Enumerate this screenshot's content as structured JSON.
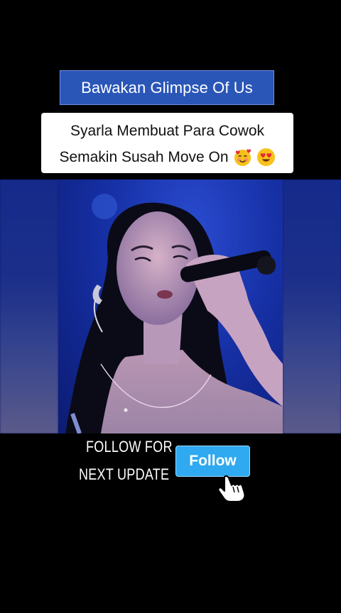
{
  "header": {
    "title": "Bawakan Glimpse Of Us"
  },
  "caption": {
    "line1": "Syarla Membuat Para Cowok",
    "line2": "Semakin Susah Move On",
    "emojis": [
      "smiling-face-with-hearts-icon",
      "heart-eyes-icon"
    ]
  },
  "video": {
    "subject": "singer-with-microphone"
  },
  "cta": {
    "follow_for": "FOLLOW FOR",
    "next_update": "NEXT UPDATE",
    "button_label": "Follow",
    "cursor_icon": "hand-pointer-icon"
  },
  "colors": {
    "title_bg": "#2a56b7",
    "button_bg": "#2fa9f0",
    "background": "#000000"
  }
}
